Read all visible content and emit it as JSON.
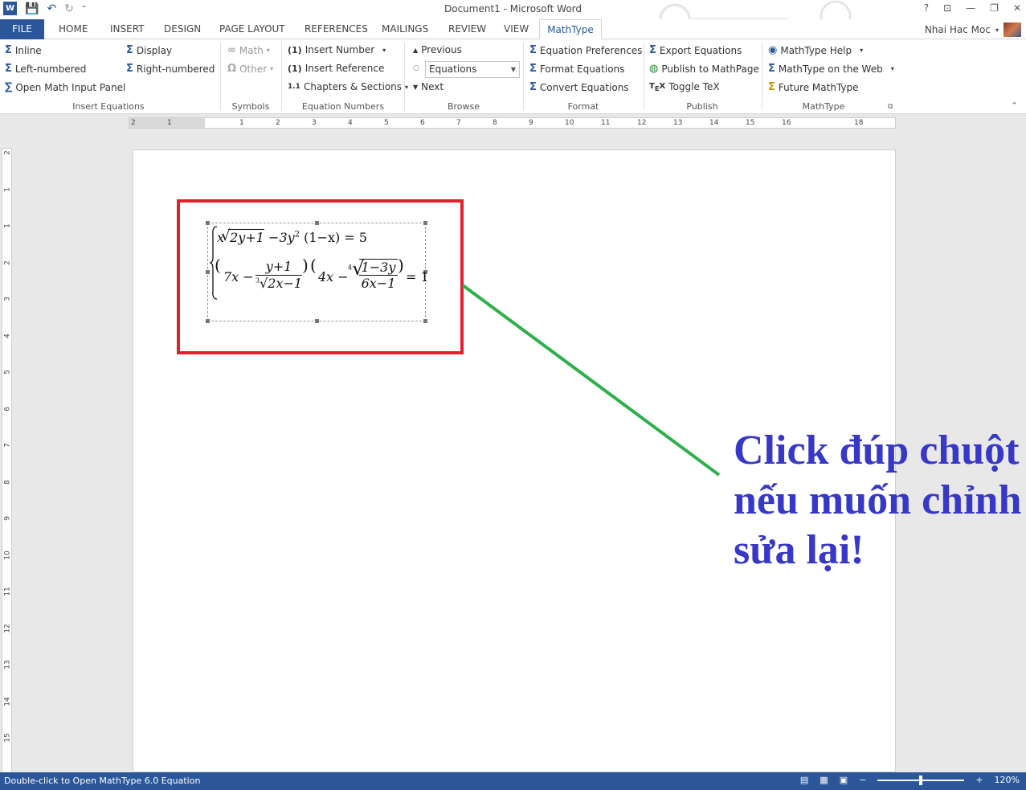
{
  "window": {
    "title": "Document1 - Microsoft Word",
    "help": "?",
    "min": "—",
    "restore": "❐",
    "close": "✕"
  },
  "qat": {
    "app_icon": "W",
    "save": "💾",
    "undo": "↶",
    "redo": "↻",
    "more": "⁼"
  },
  "tabs": {
    "file": "FILE",
    "home": "HOME",
    "insert": "INSERT",
    "design": "DESIGN",
    "page_layout": "PAGE LAYOUT",
    "references": "REFERENCES",
    "mailings": "MAILINGS",
    "review": "REVIEW",
    "view": "VIEW",
    "mathtype": "MathType"
  },
  "user": {
    "name": "Nhai Hac Moc"
  },
  "ribbon": {
    "insert_equations": {
      "label": "Insert Equations",
      "inline": "Inline",
      "display": "Display",
      "left_numbered": "Left-numbered",
      "right_numbered": "Right-numbered",
      "open_panel": "Open Math Input Panel"
    },
    "symbols": {
      "label": "Symbols",
      "math": "Math",
      "other": "Other"
    },
    "equation_numbers": {
      "label": "Equation Numbers",
      "insert_number": "Insert Number",
      "insert_reference": "Insert Reference",
      "chapters_sections": "Chapters & Sections"
    },
    "browse": {
      "label": "Browse",
      "previous": "Previous",
      "combo": "Equations",
      "next": "Next"
    },
    "format": {
      "label": "Format",
      "preferences": "Equation Preferences",
      "format_eq": "Format Equations",
      "convert_eq": "Convert Equations"
    },
    "publish": {
      "label": "Publish",
      "export": "Export Equations",
      "mathpage": "Publish to MathPage",
      "toggle_tex": "Toggle TeX"
    },
    "mathtype": {
      "label": "MathType",
      "help": "MathType Help",
      "web": "MathType on the Web",
      "future": "Future MathType"
    }
  },
  "ruler": {
    "h_ticks": [
      "2",
      "1",
      "1",
      "2",
      "3",
      "4",
      "5",
      "6",
      "7",
      "8",
      "9",
      "10",
      "11",
      "12",
      "13",
      "14",
      "15",
      "16",
      "18"
    ],
    "v_ticks": [
      "2",
      "1",
      "1",
      "2",
      "3",
      "4",
      "5",
      "6",
      "7",
      "8",
      "9",
      "10",
      "11",
      "12",
      "13",
      "14",
      "15"
    ]
  },
  "equation": {
    "line1": {
      "a": "x",
      "sqrt": "2y+1",
      "b": "−3y",
      "sup": "2",
      "c": "(1−x) = 5"
    },
    "line2": {
      "a": "7x −",
      "num1": "y+1",
      "den_idx": "3",
      "den1": "2x−1",
      "b": "4x −",
      "root_idx": "4",
      "num2": "1−3y",
      "den2": "6x−1",
      "c": "= 1"
    }
  },
  "callout": "Click đúp chuột nếu muốn chỉnh sửa lại!",
  "status": {
    "message": "Double-click to Open MathType 6.0 Equation",
    "zoom": "120%"
  }
}
